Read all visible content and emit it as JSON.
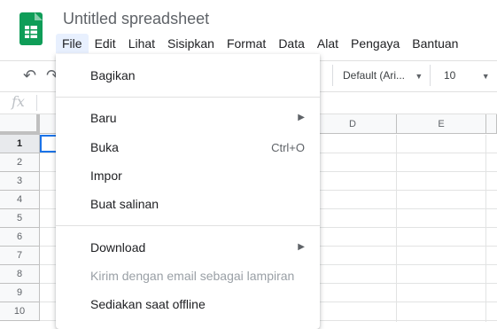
{
  "doc": {
    "title": "Untitled spreadsheet"
  },
  "menubar": [
    {
      "label": "File",
      "active": true
    },
    {
      "label": "Edit"
    },
    {
      "label": "Lihat"
    },
    {
      "label": "Sisipkan"
    },
    {
      "label": "Format"
    },
    {
      "label": "Data"
    },
    {
      "label": "Alat"
    },
    {
      "label": "Pengaya"
    },
    {
      "label": "Bantuan"
    }
  ],
  "toolbar": {
    "font": "Default (Ari...",
    "size": "10"
  },
  "formula": {
    "fx": "fx"
  },
  "columns": [
    "D",
    "E"
  ],
  "rows": [
    "1",
    "2",
    "3",
    "4",
    "5",
    "6",
    "7",
    "8",
    "9",
    "10"
  ],
  "file_menu": {
    "share": "Bagikan",
    "new": "Baru",
    "open": "Buka",
    "open_shortcut": "Ctrl+O",
    "import": "Impor",
    "copy": "Buat salinan",
    "download": "Download",
    "email": "Kirim dengan email sebagai lampiran",
    "offline": "Sediakan saat offline"
  },
  "icons": {
    "submenu": "chevron-right-icon",
    "undo": "undo-icon",
    "redo": "redo-icon"
  },
  "colors": {
    "brand": "#0f9d58",
    "selection": "#1a73e8",
    "menu_active": "#e8f0fe"
  }
}
